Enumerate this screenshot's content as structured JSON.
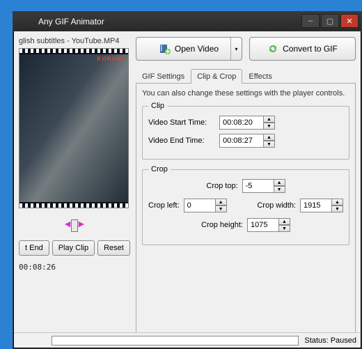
{
  "window": {
    "title": "Any GIF Animator",
    "min_label": "–",
    "max_label": "▢",
    "close_label": "✕"
  },
  "left": {
    "filename": "glish subtitles - YouTube.MP4",
    "konami": "KONAMI",
    "set_end_btn": "t End",
    "playclip_btn": "Play Clip",
    "reset_btn": "Reset",
    "time": "00:08:26"
  },
  "buttons": {
    "open": "Open Video",
    "convert": "Convert to GIF",
    "split_arrow": "▾"
  },
  "tabs": {
    "gif": "GIF Settings",
    "clipcrop": "Clip & Crop",
    "effects": "Effects"
  },
  "panel": {
    "hint": "You can also change these settings with the player controls."
  },
  "clip": {
    "legend": "Clip",
    "start_label": "Video Start Time:",
    "start_value": "00:08:20",
    "end_label": "Video End Time:",
    "end_value": "00:08:27"
  },
  "crop": {
    "legend": "Crop",
    "top_label": "Crop top:",
    "top_value": "-5",
    "left_label": "Crop left:",
    "left_value": "0",
    "width_label": "Crop width:",
    "width_value": "1915",
    "height_label": "Crop height:",
    "height_value": "1075"
  },
  "status": {
    "cell1": "",
    "label": "Status: Paused"
  },
  "icons": {
    "open_film": "film-open-icon",
    "convert_reload": "convert-icon"
  }
}
